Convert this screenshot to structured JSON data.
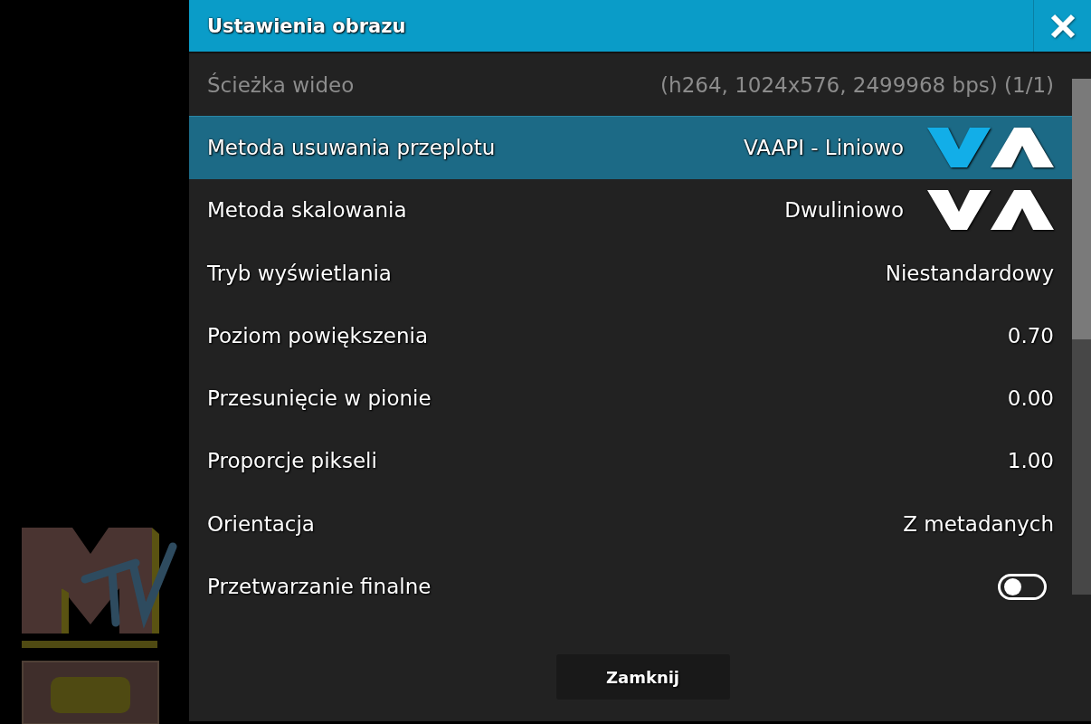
{
  "dialog": {
    "title": "Ustawienia obrazu"
  },
  "rows": [
    {
      "kind": "value",
      "label": "Ścieżka wideo",
      "value": "(h264, 1024x576, 2499968 bps) (1/1)",
      "disabled": true,
      "selected": false
    },
    {
      "kind": "spinner",
      "label": "Metoda usuwania przeplotu",
      "value": "VAAPI - Liniowo",
      "disabled": false,
      "selected": true
    },
    {
      "kind": "spinner",
      "label": "Metoda skalowania",
      "value": "Dwuliniowo",
      "disabled": false,
      "selected": false
    },
    {
      "kind": "value",
      "label": "Tryb wyświetlania",
      "value": "Niestandardowy",
      "disabled": false,
      "selected": false
    },
    {
      "kind": "value",
      "label": "Poziom powiększenia",
      "value": "0.70",
      "disabled": false,
      "selected": false
    },
    {
      "kind": "value",
      "label": "Przesunięcie w pionie",
      "value": "0.00",
      "disabled": false,
      "selected": false
    },
    {
      "kind": "value",
      "label": "Proporcje pikseli",
      "value": "1.00",
      "disabled": false,
      "selected": false
    },
    {
      "kind": "value",
      "label": "Orientacja",
      "value": "Z metadanych",
      "disabled": false,
      "selected": false
    },
    {
      "kind": "toggle",
      "label": "Przetwarzanie finalne",
      "on": false,
      "disabled": false,
      "selected": false
    }
  ],
  "buttons": [
    {
      "label": "Zamknij"
    }
  ]
}
